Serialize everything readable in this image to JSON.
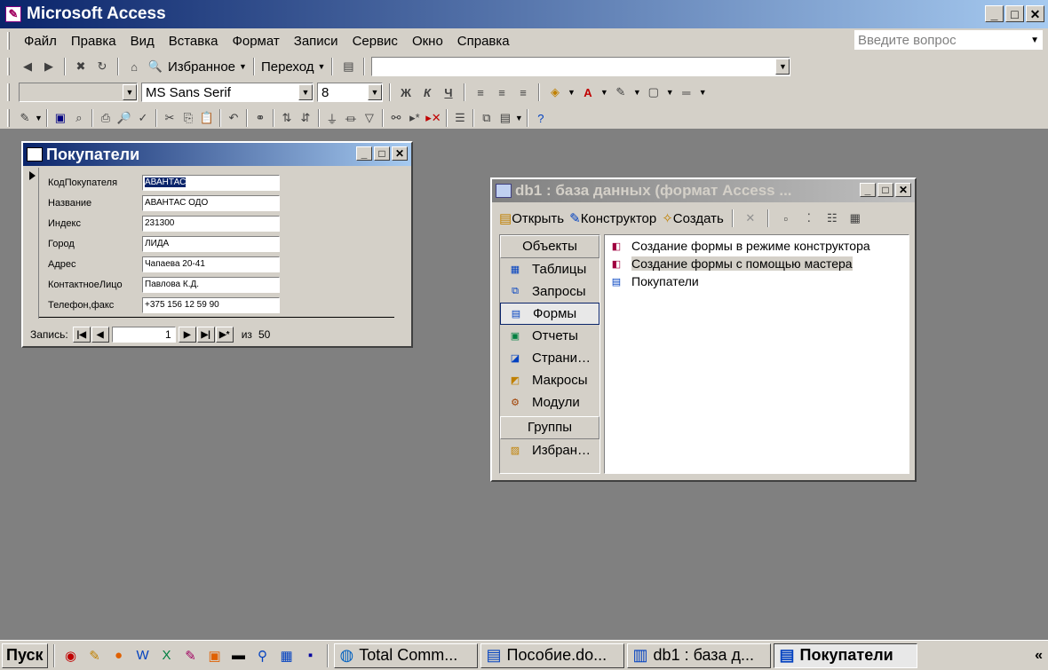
{
  "app": {
    "title": "Microsoft Access"
  },
  "menu": [
    "Файл",
    "Правка",
    "Вид",
    "Вставка",
    "Формат",
    "Записи",
    "Сервис",
    "Окно",
    "Справка"
  ],
  "help_box": {
    "placeholder": "Введите вопрос"
  },
  "web_toolbar": {
    "favorites": "Избранное",
    "goto": "Переход"
  },
  "format_toolbar": {
    "font": "MS Sans Serif",
    "size": "8",
    "bold": "Ж",
    "italic": "К",
    "underline": "Ч"
  },
  "form_window": {
    "title": "Покупатели",
    "fields": [
      {
        "label": "КодПокупателя",
        "value": "АВАНТАС"
      },
      {
        "label": "Название",
        "value": "АВАНТАС ОДО"
      },
      {
        "label": "Индекс",
        "value": "231300"
      },
      {
        "label": "Город",
        "value": "ЛИДА"
      },
      {
        "label": "Адрес",
        "value": "Чапаева 20-41"
      },
      {
        "label": "КонтактноеЛицо",
        "value": "Павлова К.Д."
      },
      {
        "label": "Телефон,факс",
        "value": "+375 156 12 59 90"
      }
    ],
    "nav": {
      "label": "Запись:",
      "current": "1",
      "of_label": "из",
      "total": "50"
    }
  },
  "db_window": {
    "title": "db1 : база данных (формат Access ...",
    "toolbar": {
      "open": "Открыть",
      "design": "Конструктор",
      "create": "Создать"
    },
    "objects_header": "Объекты",
    "objects": [
      {
        "label": "Таблицы",
        "icon": "table-icon"
      },
      {
        "label": "Запросы",
        "icon": "query-icon"
      },
      {
        "label": "Формы",
        "icon": "form-icon",
        "active": true
      },
      {
        "label": "Отчеты",
        "icon": "report-icon"
      },
      {
        "label": "Страни…",
        "icon": "page-icon"
      },
      {
        "label": "Макросы",
        "icon": "macro-icon"
      },
      {
        "label": "Модули",
        "icon": "module-icon"
      }
    ],
    "groups_header": "Группы",
    "groups": [
      {
        "label": "Избран…",
        "icon": "favorites-icon"
      }
    ],
    "items": [
      {
        "label": "Создание формы в режиме конструктора",
        "icon": "design-wizard-icon"
      },
      {
        "label": "Создание формы с помощью мастера",
        "icon": "form-wizard-icon",
        "selected": true
      },
      {
        "label": "Покупатели",
        "icon": "form-icon"
      }
    ]
  },
  "taskbar": {
    "start": "Пуск",
    "tasks": [
      {
        "label": "Total Comm...",
        "icon": "total-commander-icon"
      },
      {
        "label": "Пособие.do...",
        "icon": "word-doc-icon"
      },
      {
        "label": "db1 : база д...",
        "icon": "database-icon"
      },
      {
        "label": "Покупатели",
        "icon": "form-icon",
        "active": true
      }
    ],
    "chevron": "«"
  }
}
